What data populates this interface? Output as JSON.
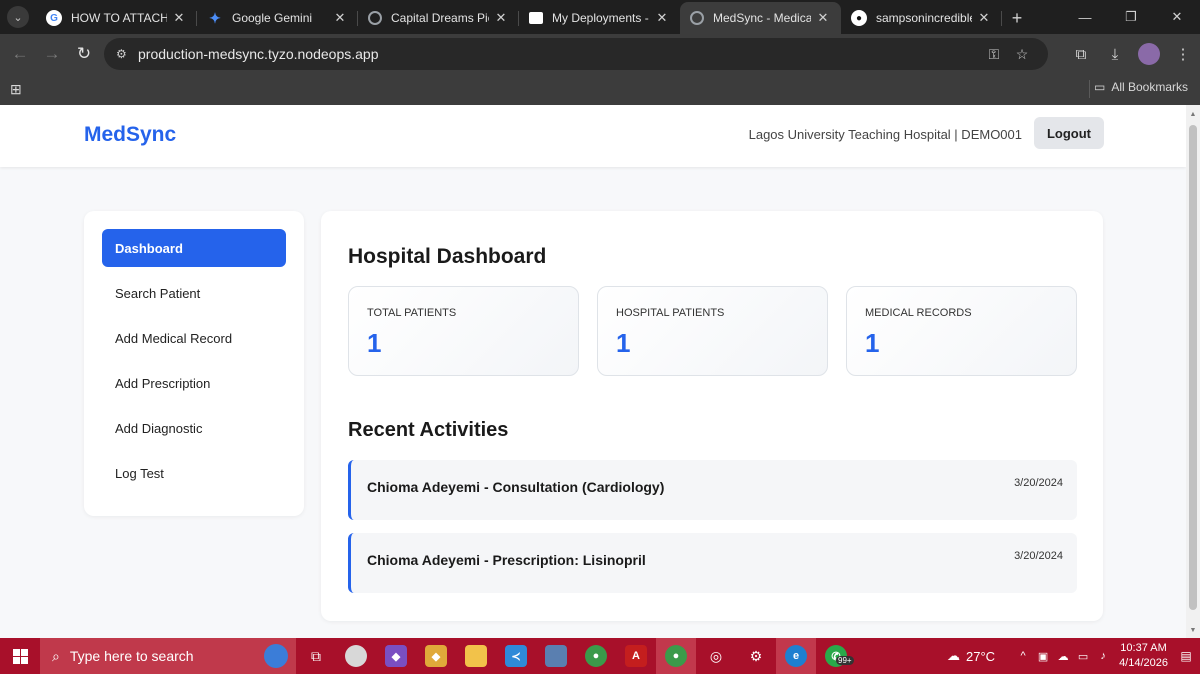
{
  "browser": {
    "tabs": [
      {
        "title": "HOW TO ATTACH LEG",
        "favicon": "google-icon",
        "color": "#ffffff"
      },
      {
        "title": "Google Gemini",
        "favicon": "gemini-icon",
        "color": "#4c8df6"
      },
      {
        "title": "Capital Dreams Pictu",
        "favicon": "globe-icon",
        "color": "#5f6368"
      },
      {
        "title": "My Deployments - M",
        "favicon": "nodeops-icon",
        "color": "#ffffff"
      },
      {
        "title": "MedSync - Medical R",
        "favicon": "globe-icon",
        "color": "#5f6368"
      },
      {
        "title": "sampsonincredible/M",
        "favicon": "github-icon",
        "color": "#ffffff"
      }
    ],
    "active_tab_index": 4,
    "url": "production-medsync.tyzo.nodeops.app",
    "bookmarks_label": "All Bookmarks"
  },
  "app": {
    "brand": "MedSync",
    "hospital_info": "Lagos University Teaching Hospital | DEMO001",
    "logout_label": "Logout",
    "accent_color": "#2563eb"
  },
  "sidebar": {
    "items": [
      {
        "label": "Dashboard",
        "active": true
      },
      {
        "label": "Search Patient",
        "active": false
      },
      {
        "label": "Add Medical Record",
        "active": false
      },
      {
        "label": "Add Prescription",
        "active": false
      },
      {
        "label": "Add Diagnostic",
        "active": false
      },
      {
        "label": "Log Test",
        "active": false
      }
    ]
  },
  "dashboard": {
    "title": "Hospital Dashboard",
    "stats": [
      {
        "label": "TOTAL PATIENTS",
        "value": "1"
      },
      {
        "label": "HOSPITAL PATIENTS",
        "value": "1"
      },
      {
        "label": "MEDICAL RECORDS",
        "value": "1"
      }
    ],
    "recent_title": "Recent Activities",
    "activities": [
      {
        "text": "Chioma Adeyemi - Consultation (Cardiology)",
        "date": "3/20/2024"
      },
      {
        "text": "Chioma Adeyemi - Prescription: Lisinopril",
        "date": "3/20/2024"
      }
    ]
  },
  "taskbar": {
    "search_placeholder": "Type here to search",
    "weather": "27°C",
    "time": "10:37 AM",
    "date": "4/14/2026",
    "badge": "99+",
    "color": "#a8102a"
  }
}
